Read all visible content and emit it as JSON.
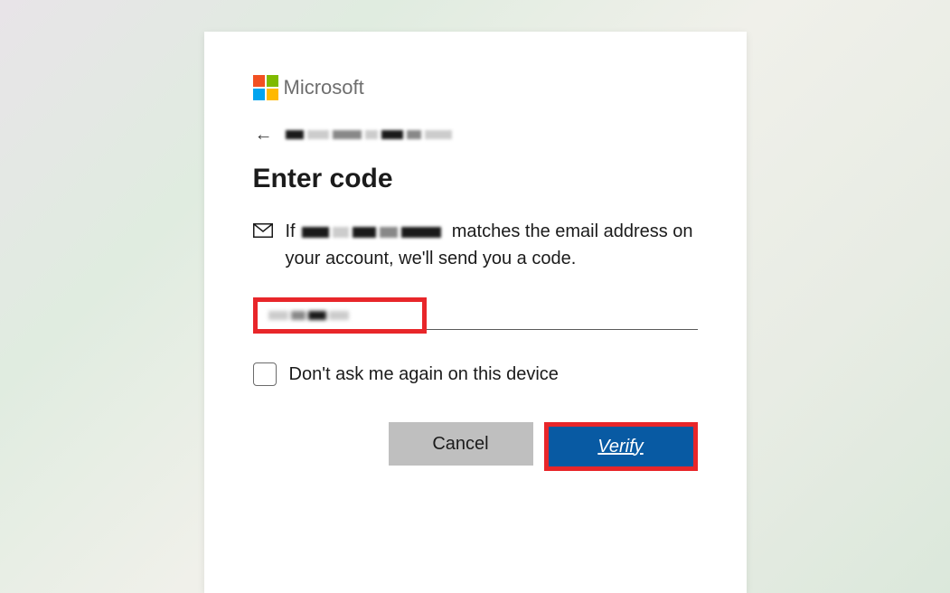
{
  "brand": {
    "name": "Microsoft",
    "colors": {
      "tl": "#f25022",
      "tr": "#7fba00",
      "bl": "#00a4ef",
      "br": "#ffb900"
    }
  },
  "page": {
    "title": "Enter code",
    "message_prefix": "If",
    "message_suffix": "matches the email address on your account, we'll send you a code."
  },
  "checkbox": {
    "label": "Don't ask me again on this device",
    "checked": false
  },
  "buttons": {
    "cancel": "Cancel",
    "verify": "Verify"
  },
  "highlight_color": "#e8262a",
  "primary_button_color": "#085aa3"
}
